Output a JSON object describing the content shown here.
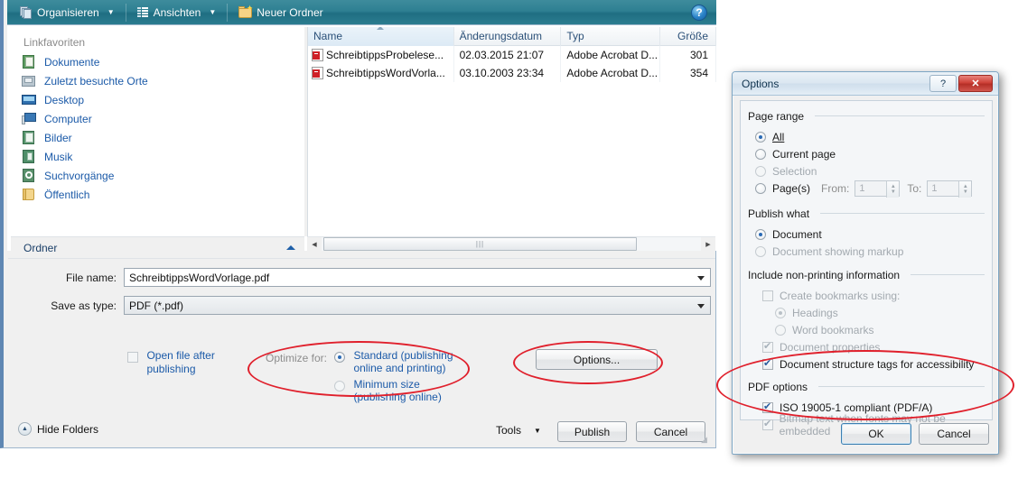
{
  "saveas": {
    "toolbar": {
      "organize_label": "Organisieren",
      "views_label": "Ansichten",
      "newfolder_label": "Neuer Ordner",
      "help_glyph": "?"
    },
    "nav": {
      "title": "Linkfavoriten",
      "items": [
        {
          "label": "Dokumente",
          "icon": "documents-icon"
        },
        {
          "label": "Zuletzt besuchte Orte",
          "icon": "recent-places-icon"
        },
        {
          "label": "Desktop",
          "icon": "desktop-icon"
        },
        {
          "label": "Computer",
          "icon": "computer-icon"
        },
        {
          "label": "Bilder",
          "icon": "pictures-icon"
        },
        {
          "label": "Musik",
          "icon": "music-icon"
        },
        {
          "label": "Suchvorgänge",
          "icon": "searches-icon"
        },
        {
          "label": "Öffentlich",
          "icon": "public-folder-icon"
        }
      ],
      "folders_label": "Ordner"
    },
    "filelist": {
      "columns": [
        "Name",
        "Änderungsdatum",
        "Typ",
        "Größe"
      ],
      "sorted_column": "Name",
      "rows": [
        {
          "name": "SchreibtippsProbelese...",
          "date": "02.03.2015 21:07",
          "type": "Adobe Acrobat D...",
          "size": "301"
        },
        {
          "name": "SchreibtippsWordVorla...",
          "date": "03.10.2003 23:34",
          "type": "Adobe Acrobat D...",
          "size": "354"
        }
      ]
    },
    "form": {
      "filename_label": "File name:",
      "filename_value": "SchreibtippsWordVorlage.pdf",
      "savetype_label": "Save as type:",
      "savetype_value": "PDF (*.pdf)",
      "open_after_publishing": "Open file after publishing",
      "open_after_checked": false,
      "optimize_label": "Optimize for:",
      "optimize_standard": "Standard (publishing online and printing)",
      "optimize_minimum": "Minimum size (publishing online)",
      "optimize_selected": "standard",
      "options_button": "Options..."
    },
    "footer": {
      "hide_folders": "Hide Folders",
      "tools": "Tools",
      "publish": "Publish",
      "cancel": "Cancel"
    }
  },
  "options_dialog": {
    "title": "Options",
    "help_glyph": "?",
    "close_glyph": "✕",
    "groups": {
      "page_range": {
        "title": "Page range",
        "items": [
          {
            "label": "All",
            "type": "radio",
            "checked": true,
            "disabled": false
          },
          {
            "label": "Current page",
            "type": "radio",
            "checked": false,
            "disabled": false
          },
          {
            "label": "Selection",
            "type": "radio",
            "checked": false,
            "disabled": true
          },
          {
            "label": "Page(s)",
            "type": "radio",
            "checked": false,
            "disabled": false
          }
        ],
        "from_label": "From:",
        "from_value": "1",
        "to_label": "To:",
        "to_value": "1"
      },
      "publish_what": {
        "title": "Publish what",
        "items": [
          {
            "label": "Document",
            "type": "radio",
            "checked": true,
            "disabled": false
          },
          {
            "label": "Document showing markup",
            "type": "radio",
            "checked": false,
            "disabled": true
          }
        ]
      },
      "include_nonprinting": {
        "title": "Include non-printing information",
        "items": [
          {
            "label": "Create bookmarks using:",
            "type": "check",
            "checked": false,
            "disabled": true
          },
          {
            "label": "Headings",
            "type": "radio",
            "checked": true,
            "disabled": true
          },
          {
            "label": "Word bookmarks",
            "type": "radio",
            "checked": false,
            "disabled": true
          },
          {
            "label": "Document properties",
            "type": "check",
            "checked": true,
            "disabled": true
          },
          {
            "label": "Document structure tags for accessibility",
            "type": "check",
            "checked": true,
            "disabled": false
          }
        ]
      },
      "pdf_options": {
        "title": "PDF options",
        "items": [
          {
            "label": "ISO 19005-1 compliant (PDF/A)",
            "type": "check",
            "checked": true,
            "disabled": false
          },
          {
            "label": "Bitmap text when fonts may not be embedded",
            "type": "check",
            "checked": true,
            "disabled": true
          }
        ]
      }
    },
    "ok_button": "OK",
    "cancel_button": "Cancel"
  },
  "annotations": {
    "color": "#e0202c",
    "ellipses": [
      {
        "name": "optimize-for-highlight"
      },
      {
        "name": "options-button-highlight"
      },
      {
        "name": "pdf-options-highlight"
      }
    ]
  }
}
